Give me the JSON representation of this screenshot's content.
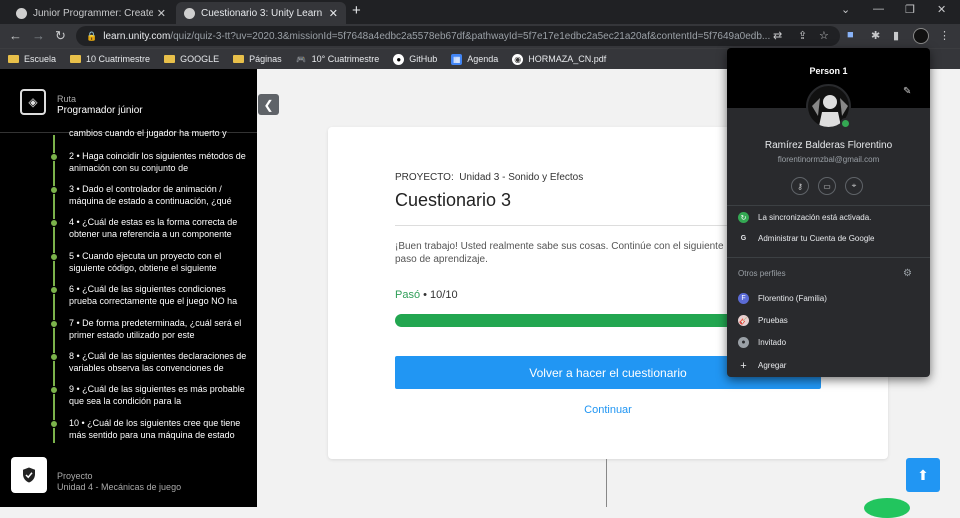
{
  "browser": {
    "tabs": [
      {
        "title": "Junior Programmer: Create with C"
      },
      {
        "title": "Cuestionario 3: Unity Learn"
      }
    ],
    "url_host": "learn.unity.com",
    "url_rest": "/quiz/quiz-3-tt?uv=2020.3&missionId=5f7648a4edbc2a5578eb67df&pathwayId=5f7e17e1edbc2a5ec21a20af&contentId=5f7649a0edb...",
    "bookmarks": [
      "Escuela",
      "10 Cuatrimestre",
      "GOOGLE",
      "Páginas",
      "10° Cuatrimestre",
      "GitHub",
      "Agenda",
      "HORMAZA_CN.pdf"
    ]
  },
  "sidebar": {
    "route_label": "Ruta",
    "path_name": "Programador júnior",
    "top_partial": "cambios cuando el jugador ha muerto y",
    "items": [
      {
        "text": "2 • Haga coincidir los siguientes métodos de animación con su conjunto de"
      },
      {
        "text": "3 • Dado el controlador de animación / máquina de estado a continuación, ¿qué"
      },
      {
        "text": "4 • ¿Cuál de estas es la forma correcta de obtener una referencia a un componente"
      },
      {
        "text": "5 • Cuando ejecuta un proyecto con el siguiente código, obtiene el siguiente"
      },
      {
        "text": "6 • ¿Cuál de las siguientes condiciones prueba correctamente que el juego NO ha"
      },
      {
        "text": "7 • De forma predeterminada, ¿cuál será el primer estado utilizado por este"
      },
      {
        "text": "8 • ¿Cuál de las siguientes declaraciones de variables observa las convenciones de"
      },
      {
        "text": "9 • ¿Cuál de las siguientes es más probable que sea la condición para la"
      },
      {
        "text": "10 • ¿Cuál de los siguientes cree que tiene más sentido para una máquina de estado"
      }
    ],
    "footer_label": "Proyecto",
    "footer_value": "Unidad 4 - Mecánicas de juego"
  },
  "quiz": {
    "project_label": "PROYECTO:",
    "project_value": "Unidad 3 - Sonido y Efectos",
    "title": "Cuestionario 3",
    "message": "¡Buen trabajo! Usted realmente sabe sus cosas. Continúe con el siguiente paso de aprendizaje.",
    "pass_label": "Pasó",
    "score": "10/10",
    "progress_fraction": 1.0,
    "retake_label": "Volver a hacer el cuestionario",
    "continue_label": "Continuar"
  },
  "profile_popup": {
    "header_name": "Person 1",
    "full_name": "Ramírez Balderas Florentino",
    "email": "florentinormzbal@gmail.com",
    "sync_text": "La sincronización está activada.",
    "manage_text": "Administrar tu Cuenta de Google",
    "other_profiles_label": "Otros perfiles",
    "profiles": [
      {
        "name": "Florentino (Familia)",
        "initial": "F",
        "color": "#5b6bd5"
      },
      {
        "name": "Pruebas",
        "initial": "🎸",
        "color": "#e8d0d0"
      },
      {
        "name": "Invitado",
        "initial": "●",
        "color": "#9aa0a6"
      }
    ],
    "add_label": "Agregar"
  },
  "colors": {
    "accent": "#2196f3",
    "progress": "#22a650",
    "sidebar_line": "#7bb24b"
  }
}
